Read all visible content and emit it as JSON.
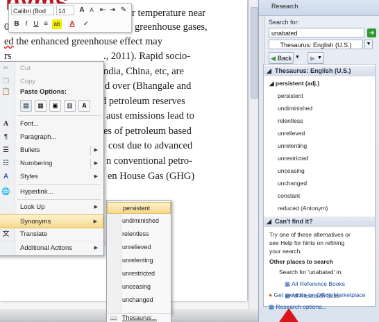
{
  "doc": {
    "title_fragment": "nyms",
    "lines": [
      {
        "pre": "",
        "red": "",
        "text": "r temperature near"
      },
      {
        "pre": "0",
        "red": "",
        "text": "greenhouse gases,"
      },
      {
        "pre": "",
        "red": "ed",
        "text": " the enhanced greenhouse effect may"
      },
      {
        "pre": "rs",
        "red": "",
        "text": "., 2011). Rapid socio-"
      },
      {
        "pre": "g",
        "red": "",
        "text": "ndia, China, etc, are"
      },
      {
        "pre": "n",
        "red": "",
        "text": "d over (Bhangale and"
      },
      {
        "pre": "1",
        "red": "",
        "text": "d petroleum reserves"
      },
      {
        "pre": "v",
        "red": "",
        "text": "aust emissions lead to"
      },
      {
        "pre": "c",
        "red": "",
        "text": "es of petroleum based"
      },
      {
        "pre": "a",
        "red": "",
        "text": "cost due to advanced"
      },
      {
        "pre": "e",
        "red": "",
        "text": "n conventional petro-"
      },
      {
        "pre": "",
        "red": "",
        "text": "en House Gas (GHG)"
      },
      {
        "pre": "o",
        "red": "",
        "text": ""
      }
    ]
  },
  "mini_toolbar": {
    "font": "Calibri (Bod",
    "size": "14",
    "grow": "A",
    "shrink": "A",
    "bold": "B",
    "italic": "I",
    "underline": "U",
    "center": "≡",
    "highlight": "ab",
    "color": "A"
  },
  "context_menu": {
    "cut": "Cut",
    "copy": "Copy",
    "paste_header": "Paste Options:",
    "paste_buttons": [
      "",
      "",
      "",
      "",
      "A"
    ],
    "font": "Font...",
    "paragraph": "Paragraph...",
    "bullets": "Bullets",
    "numbering": "Numbering",
    "styles": "Styles",
    "hyperlink": "Hyperlink...",
    "lookup": "Look Up",
    "synonyms": "Synonyms",
    "translate": "Translate",
    "additional": "Additional Actions"
  },
  "synonyms_submenu": [
    "persistent",
    "undiminished",
    "relentless",
    "unrelieved",
    "unrelenting",
    "unrestricted",
    "unceasing",
    "unchanged"
  ],
  "thesaurus_item": "Thesaurus...",
  "research": {
    "header": "Research",
    "search_for": "Search for:",
    "query": "unabated",
    "source": "Thesaurus: English (U.S.)",
    "back": "Back",
    "section1": "Thesaurus: English (U.S.)",
    "head_word": "persistent (adj.)",
    "results": [
      "persistent",
      "undiminished",
      "relentless",
      "unrelieved",
      "unrelenting",
      "unrestricted",
      "unceasing",
      "unchanged",
      "constant",
      "reduced (Antonym)"
    ],
    "section2": "Can't find it?",
    "help_text": [
      "Try one of these alternatives or",
      "see Help for hints on refining",
      "your search."
    ],
    "other_places": "Other places to search",
    "search_in": "Search for 'unabated' in:",
    "all_ref": "All Reference Books",
    "all_sites": "All Research Sites",
    "marketplace": "Get services on Office Marketplace",
    "options": "Research options..."
  },
  "colors": {
    "accent_red": "#c0161c",
    "highlight": "#f7d98c",
    "pane_bg": "#e3e9f2"
  }
}
